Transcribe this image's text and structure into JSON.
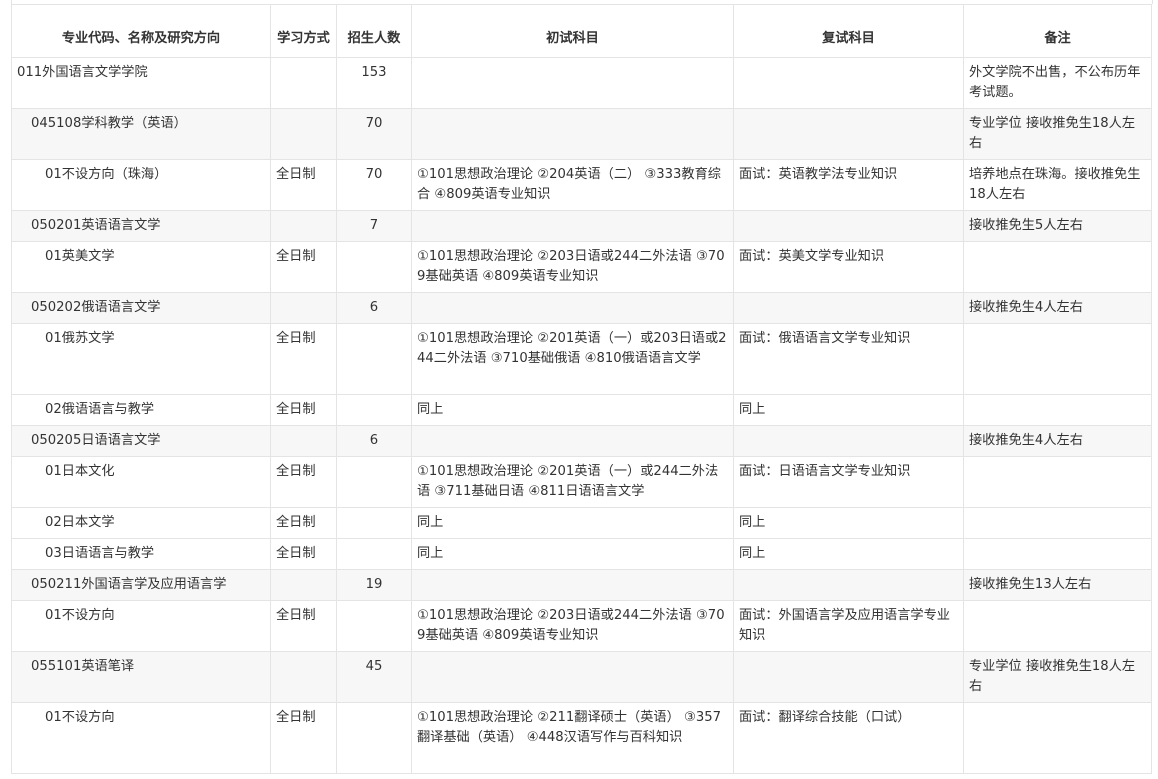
{
  "headers": {
    "name": "专业代码、名称及研究方向",
    "mode": "学习方式",
    "quota": "招生人数",
    "prelim": "初试科目",
    "retest": "复试科目",
    "remark": "备注"
  },
  "rows": [
    {
      "level": 1,
      "group": false,
      "name": "011外国语言文学学院",
      "mode": "",
      "quota": "153",
      "prelim": "",
      "retest": "",
      "remark": "外文学院不出售，不公布历年考试题。"
    },
    {
      "level": 2,
      "group": true,
      "name": "045108学科教学（英语）",
      "mode": "",
      "quota": "70",
      "prelim": "",
      "retest": "",
      "remark": "专业学位 接收推免生18人左右"
    },
    {
      "level": 3,
      "group": false,
      "name": "01不设方向（珠海）",
      "mode": "全日制",
      "quota": "70",
      "prelim": "①101思想政治理论 ②204英语（二） ③333教育综合 ④809英语专业知识",
      "retest": "面试：英语教学法专业知识",
      "remark": "培养地点在珠海。接收推免生18人左右"
    },
    {
      "level": 2,
      "group": true,
      "name": "050201英语语言文学",
      "mode": "",
      "quota": "7",
      "prelim": "",
      "retest": "",
      "remark": "接收推免生5人左右"
    },
    {
      "level": 3,
      "group": false,
      "name": "01英美文学",
      "mode": "全日制",
      "quota": "",
      "prelim": "①101思想政治理论 ②203日语或244二外法语 ③709基础英语 ④809英语专业知识",
      "retest": "面试：英美文学专业知识",
      "remark": ""
    },
    {
      "level": 2,
      "group": true,
      "name": "050202俄语语言文学",
      "mode": "",
      "quota": "6",
      "prelim": "",
      "retest": "",
      "remark": "接收推免生4人左右"
    },
    {
      "level": 3,
      "group": false,
      "name": "01俄苏文学",
      "mode": "全日制",
      "quota": "",
      "prelim": "①101思想政治理论 ②201英语（一）或203日语或244二外法语 ③710基础俄语 ④810俄语语言文学",
      "retest": "面试：俄语语言文学专业知识",
      "remark": ""
    },
    {
      "level": 3,
      "group": false,
      "name": "02俄语语言与教学",
      "mode": "全日制",
      "quota": "",
      "prelim": "同上",
      "retest": "同上",
      "remark": ""
    },
    {
      "level": 2,
      "group": true,
      "name": "050205日语语言文学",
      "mode": "",
      "quota": "6",
      "prelim": "",
      "retest": "",
      "remark": "接收推免生4人左右"
    },
    {
      "level": 3,
      "group": false,
      "name": "01日本文化",
      "mode": "全日制",
      "quota": "",
      "prelim": "①101思想政治理论 ②201英语（一）或244二外法语 ③711基础日语 ④811日语语言文学",
      "retest": "面试：日语语言文学专业知识",
      "remark": ""
    },
    {
      "level": 3,
      "group": false,
      "name": "02日本文学",
      "mode": "全日制",
      "quota": "",
      "prelim": "同上",
      "retest": "同上",
      "remark": ""
    },
    {
      "level": 3,
      "group": false,
      "name": "03日语语言与教学",
      "mode": "全日制",
      "quota": "",
      "prelim": "同上",
      "retest": "同上",
      "remark": ""
    },
    {
      "level": 2,
      "group": true,
      "name": "050211外国语言学及应用语言学",
      "mode": "",
      "quota": "19",
      "prelim": "",
      "retest": "",
      "remark": "接收推免生13人左右"
    },
    {
      "level": 3,
      "group": false,
      "name": "01不设方向",
      "mode": "全日制",
      "quota": "",
      "prelim": "①101思想政治理论 ②203日语或244二外法语 ③709基础英语 ④809英语专业知识",
      "retest": "面试：外国语言学及应用语言学专业知识",
      "remark": ""
    },
    {
      "level": 2,
      "group": true,
      "name": "055101英语笔译",
      "mode": "",
      "quota": "45",
      "prelim": "",
      "retest": "",
      "remark": "专业学位 接收推免生18人左右"
    },
    {
      "level": 3,
      "group": false,
      "name": "01不设方向",
      "mode": "全日制",
      "quota": "",
      "prelim": "①101思想政治理论 ②211翻译硕士（英语） ③357翻译基础（英语） ④448汉语写作与百科知识",
      "retest": "面试：翻译综合技能（口试）",
      "remark": ""
    }
  ]
}
